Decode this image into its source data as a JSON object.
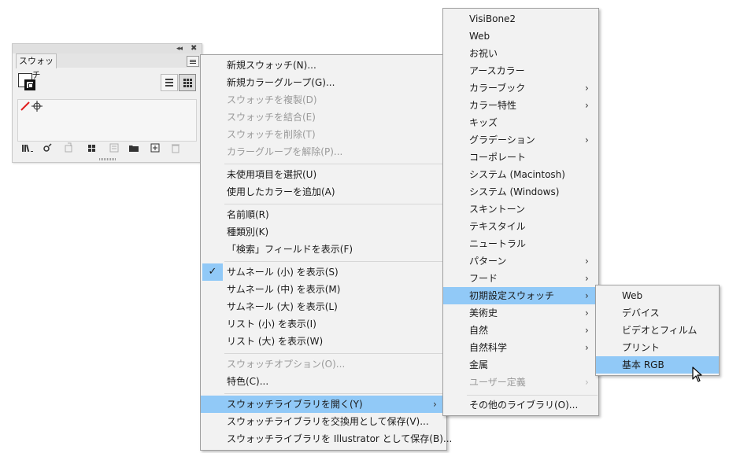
{
  "panel": {
    "tab_label": "スウォッチ",
    "collapse": "◂◂",
    "close": "✖"
  },
  "main_menu": {
    "groups": [
      [
        "新規スウォッチ(N)...",
        "新規カラーグループ(G)...",
        "スウォッチを複製(D)",
        "スウォッチを結合(E)",
        "スウォッチを削除(T)",
        "カラーグループを解除(P)..."
      ],
      [
        "未使用項目を選択(U)",
        "使用したカラーを追加(A)"
      ],
      [
        "名前順(R)",
        "種類別(K)",
        "「検索」フィールドを表示(F)"
      ],
      [
        "サムネール (小) を表示(S)",
        "サムネール (中) を表示(M)",
        "サムネール (大) を表示(L)",
        "リスト (小) を表示(I)",
        "リスト (大) を表示(W)"
      ],
      [
        "スウォッチオプション(O)...",
        "特色(C)..."
      ],
      [
        "スウォッチライブラリを開く(Y)",
        "スウォッチライブラリを交換用として保存(V)...",
        "スウォッチライブラリを Illustrator として保存(B)..."
      ]
    ],
    "check_mark": "✓"
  },
  "library_menu": {
    "items": [
      "VisiBone2",
      "Web",
      "お祝い",
      "アースカラー",
      "カラーブック",
      "カラー特性",
      "キッズ",
      "グラデーション",
      "コーポレート",
      "システム (Macintosh)",
      "システム (Windows)",
      "スキントーン",
      "テキスタイル",
      "ニュートラル",
      "パターン",
      "フード",
      "初期設定スウォッチ",
      "美術史",
      "自然",
      "自然科学",
      "金属",
      "ユーザー定義"
    ],
    "other": "その他のライブラリ(O)...",
    "arrow": "›"
  },
  "defaults_menu": {
    "items": [
      "Web",
      "デバイス",
      "ビデオとフィルム",
      "プリント",
      "基本 RGB"
    ]
  },
  "colors": {
    "highlight": "#91c9f7",
    "menu_bg": "#f2f2f2",
    "disabled": "#9a9a9a",
    "none_red": "#e02020"
  }
}
